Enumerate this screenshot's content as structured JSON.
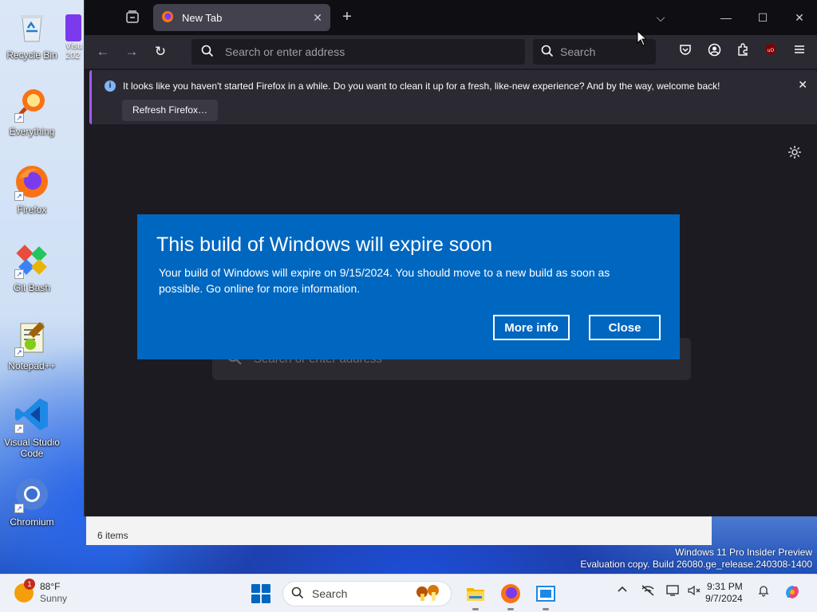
{
  "desktop": {
    "icons": [
      {
        "label": "Recycle Bin",
        "icon": "recycle-bin-icon"
      },
      {
        "label": "Everything",
        "icon": "everything-icon"
      },
      {
        "label": "Firefox",
        "icon": "firefox-icon"
      },
      {
        "label": "Git Bash",
        "icon": "git-bash-icon"
      },
      {
        "label": "Notepad++",
        "icon": "notepad-plus-plus-icon"
      },
      {
        "label": "Visual Studio Code",
        "icon": "vscode-icon"
      },
      {
        "label": "Chromium",
        "icon": "chromium-icon"
      }
    ],
    "partial_icon_label": "Visu\n202",
    "watermark": {
      "line1": "Windows 11 Pro Insider Preview",
      "line2": "Evaluation copy. Build 26080.ge_release.240308-1400"
    },
    "explorer_status": "6 items"
  },
  "firefox": {
    "tab": {
      "title": "New Tab",
      "close": "✕"
    },
    "new_tab": "+",
    "window_controls": {
      "list_all_tabs": "⌵",
      "minimize": "—",
      "maximize": "☐",
      "close": "✕"
    },
    "nav": {
      "back": "←",
      "forward": "→",
      "reload": "↻",
      "url_placeholder": "Search or enter address",
      "search_placeholder": "Search"
    },
    "notification": {
      "message": "It looks like you haven't started Firefox in a while. Do you want to clean it up for a fresh, like-new experience? And by the way, welcome back!",
      "button": "Refresh Firefox…",
      "close": "✕",
      "accent": "#a05aff"
    },
    "newtab_search_placeholder": "Search or enter address"
  },
  "dialog": {
    "title": "This build of Windows will expire soon",
    "body": "Your build of Windows will expire on 9/15/2024. You should move to a new build as soon as possible. Go online for more information.",
    "more_info": "More info",
    "close": "Close",
    "background": "#0067c0"
  },
  "taskbar": {
    "weather": {
      "temp": "88°F",
      "condition": "Sunny",
      "badge": "1"
    },
    "search_placeholder": "Search",
    "clock": {
      "time": "9:31 PM",
      "date": "9/7/2024"
    }
  }
}
